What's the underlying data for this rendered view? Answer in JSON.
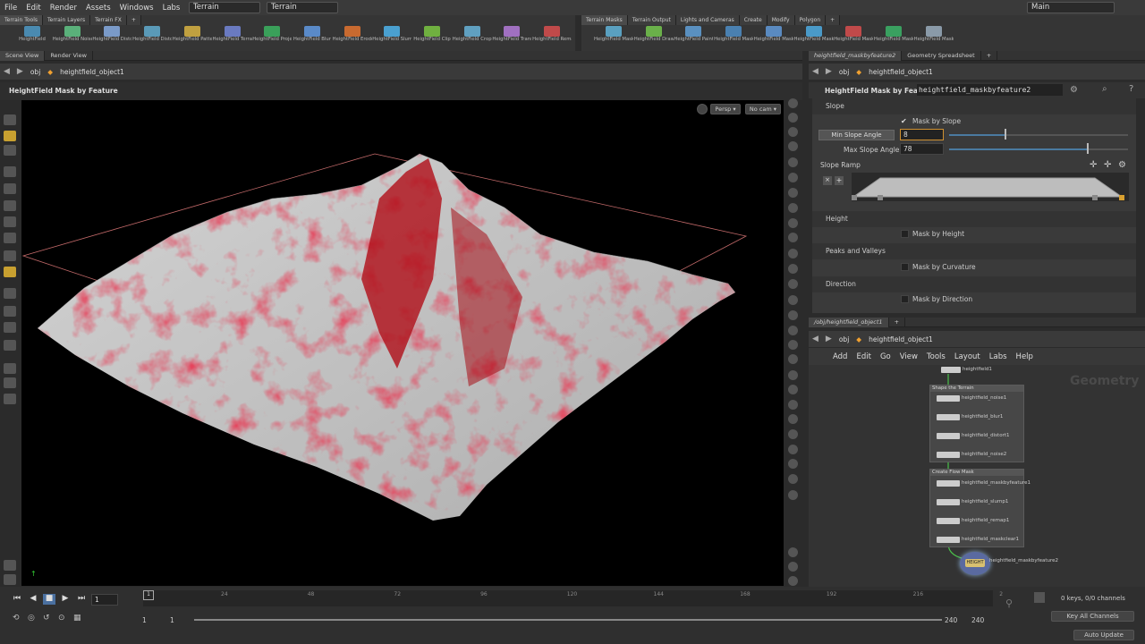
{
  "menubar": {
    "items": [
      "File",
      "Edit",
      "Render",
      "Assets",
      "Windows",
      "Labs",
      "Help"
    ],
    "desktop": "Terrain",
    "context": "Terrain",
    "main": "Main"
  },
  "shelf_left": {
    "tabs": [
      "Terrain Tools",
      "Terrain Layers",
      "Terrain FX"
    ],
    "tools": [
      "HeightField",
      "HeightField Noise",
      "HeightField Distort by N",
      "HeightField Distort by L",
      "HeightField Pattern",
      "HeightField Terrace",
      "HeightField Project",
      "HeightField Blur",
      "HeightField Erode",
      "HeightField Slump",
      "HeightField Clip",
      "HeightField Crop",
      "HeightField Transform",
      "HeightField Remap"
    ]
  },
  "shelf_right": {
    "tabs": [
      "Terrain Masks",
      "Terrain Output",
      "Lights and Cameras",
      "Create",
      "Modify",
      "Polygon"
    ],
    "tools": [
      "HeightField Mask Noise",
      "HeightField Draw Mask",
      "HeightField Paint",
      "HeightField Mask Blur",
      "HeightField Mask Expand",
      "HeightField Mask Shrink",
      "HeightField Mask by Fea",
      "HeightField Mask by Obj",
      "HeightField Mask Clear"
    ]
  },
  "scene_view": {
    "tabs": [
      "Scene View",
      "Render View"
    ],
    "path_root": "obj",
    "path_obj": "heightfield_object1",
    "title": "HeightField Mask by Feature",
    "persp": "Persp",
    "cam": "No cam"
  },
  "params": {
    "tabs": [
      "heightfield_maskbyfeature2",
      "Geometry Spreadsheet"
    ],
    "path_root": "obj",
    "path_obj": "heightfield_object1",
    "node_type": "HeightField Mask by Feature",
    "node_name": "heightfield_maskbyfeature2",
    "slope_section": "Slope",
    "mask_by_slope": "Mask by Slope",
    "min_slope_label": "Min Slope Angle",
    "min_slope_value": "8",
    "min_slope_fraction": 0.31,
    "max_slope_label": "Max Slope Angle",
    "max_slope_value": "78",
    "max_slope_fraction": 0.77,
    "slope_ramp": "Slope Ramp",
    "height_section": "Height",
    "mask_by_height": "Mask by Height",
    "peaks_section": "Peaks and Valleys",
    "mask_by_curvature": "Mask by Curvature",
    "direction_section": "Direction",
    "mask_by_direction": "Mask by Direction"
  },
  "network": {
    "tab": "/obj/heightfield_object1",
    "path_root": "obj",
    "path_obj": "heightfield_object1",
    "menu": [
      "Add",
      "Edit",
      "Go",
      "View",
      "Tools",
      "Layout",
      "Labs",
      "Help"
    ],
    "context_label": "Geometry",
    "top_node": "heightfield1",
    "box1_title": "Shape the Terrain",
    "box1_nodes": [
      "heightfield_noise1",
      "heightfield_blur1",
      "heightfield_distort1",
      "heightfield_noise2"
    ],
    "box2_title": "Create Flow Mask",
    "box2_nodes": [
      "heightfield_maskbyfeature1",
      "heightfield_slump1",
      "heightfield_remap1",
      "heightfield_maskclear1"
    ],
    "selected_node": "heightfield_maskbyfeature2",
    "selected_icon_text": "HEIGHT"
  },
  "timeline": {
    "frame": "1",
    "ticks": [
      "24",
      "48",
      "72",
      "96",
      "120",
      "144",
      "168",
      "192",
      "216",
      "2"
    ],
    "start": "1",
    "start2": "1",
    "end": "240",
    "end2": "240",
    "keys": "0 keys, 0/0 channels",
    "key_all": "Key All Channels",
    "auto_update": "Auto Update"
  },
  "colors": {
    "mask_red": "#c8101c",
    "terrain_grey": "#c9c9c9",
    "accent_blue": "#4a7aa0"
  }
}
